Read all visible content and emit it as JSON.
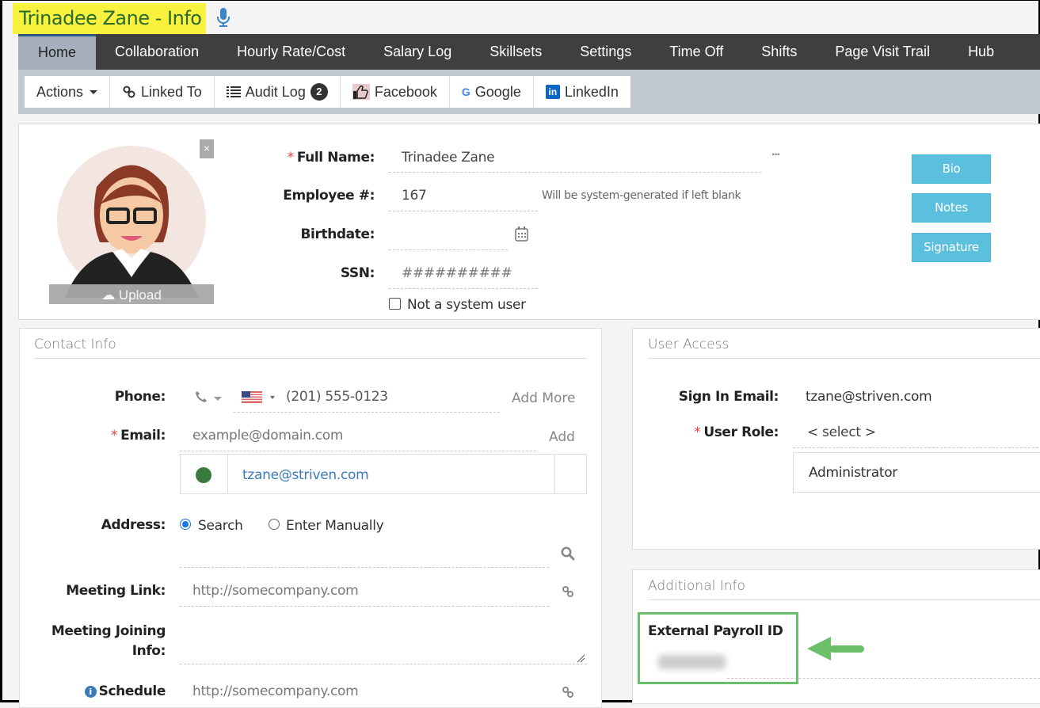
{
  "page": {
    "title": "Trinadee Zane - Info",
    "title_highlight_color": "#f8f13d"
  },
  "nav": {
    "tabs": [
      {
        "label": "Home",
        "active": true
      },
      {
        "label": "Collaboration",
        "active": false
      },
      {
        "label": "Hourly Rate/Cost",
        "active": false
      },
      {
        "label": "Salary Log",
        "active": false
      },
      {
        "label": "Skillsets",
        "active": false
      },
      {
        "label": "Settings",
        "active": false
      },
      {
        "label": "Time Off",
        "active": false
      },
      {
        "label": "Shifts",
        "active": false
      },
      {
        "label": "Page Visit Trail",
        "active": false
      },
      {
        "label": "Hub",
        "active": false
      }
    ]
  },
  "toolbar": {
    "actions_label": "Actions",
    "linked_to_label": "Linked To",
    "audit_log_label": "Audit Log",
    "audit_log_count": "2",
    "facebook_label": "Facebook",
    "google_label": "Google",
    "linkedin_label": "LinkedIn"
  },
  "profile": {
    "avatar_close": "×",
    "upload_label": "Upload",
    "full_name_label": "Full Name:",
    "full_name_value": "Trinadee Zane",
    "more_icon": "···",
    "employee_num_label": "Employee #:",
    "employee_num_value": "167",
    "employee_num_hint": "Will be system-generated if left blank",
    "birthdate_label": "Birthdate:",
    "birthdate_value": "",
    "ssn_label": "SSN:",
    "ssn_value": "##########",
    "not_system_user_label": "Not a system user",
    "not_system_user_checked": false,
    "buttons": {
      "bio": "Bio",
      "notes": "Notes",
      "signature": "Signature"
    },
    "button_color": "#5bc0de"
  },
  "contact_info": {
    "title": "Contact Info",
    "phone_label": "Phone:",
    "phone_value": "(201) 555-0123",
    "phone_country": "US",
    "add_more_label": "Add More",
    "email_label": "Email:",
    "email_placeholder": "example@domain.com",
    "email_add_label": "Add",
    "emails": [
      {
        "address": "tzane@striven.com",
        "status_color": "#3b7a3e"
      }
    ],
    "address_label": "Address:",
    "address_options": [
      {
        "label": "Search",
        "selected": true
      },
      {
        "label": "Enter Manually",
        "selected": false
      }
    ],
    "address_value": "",
    "meeting_link_label": "Meeting Link:",
    "meeting_link_placeholder": "http://somecompany.com",
    "meeting_joining_label_line1": "Meeting Joining",
    "meeting_joining_label_line2": "Info:",
    "meeting_joining_value": "",
    "schedule_label": "Schedule",
    "schedule_placeholder": "http://somecompany.com"
  },
  "user_access": {
    "title": "User Access",
    "sign_in_email_label": "Sign In Email:",
    "sign_in_email_value": "tzane@striven.com",
    "user_role_label": "User Role:",
    "user_role_placeholder": "< select >",
    "selected_roles": [
      "Administrator"
    ]
  },
  "additional_info": {
    "title": "Additional Info",
    "external_payroll_label": "External Payroll ID",
    "external_payroll_value": "(blurred)",
    "highlight_color": "#6cbf6a"
  }
}
